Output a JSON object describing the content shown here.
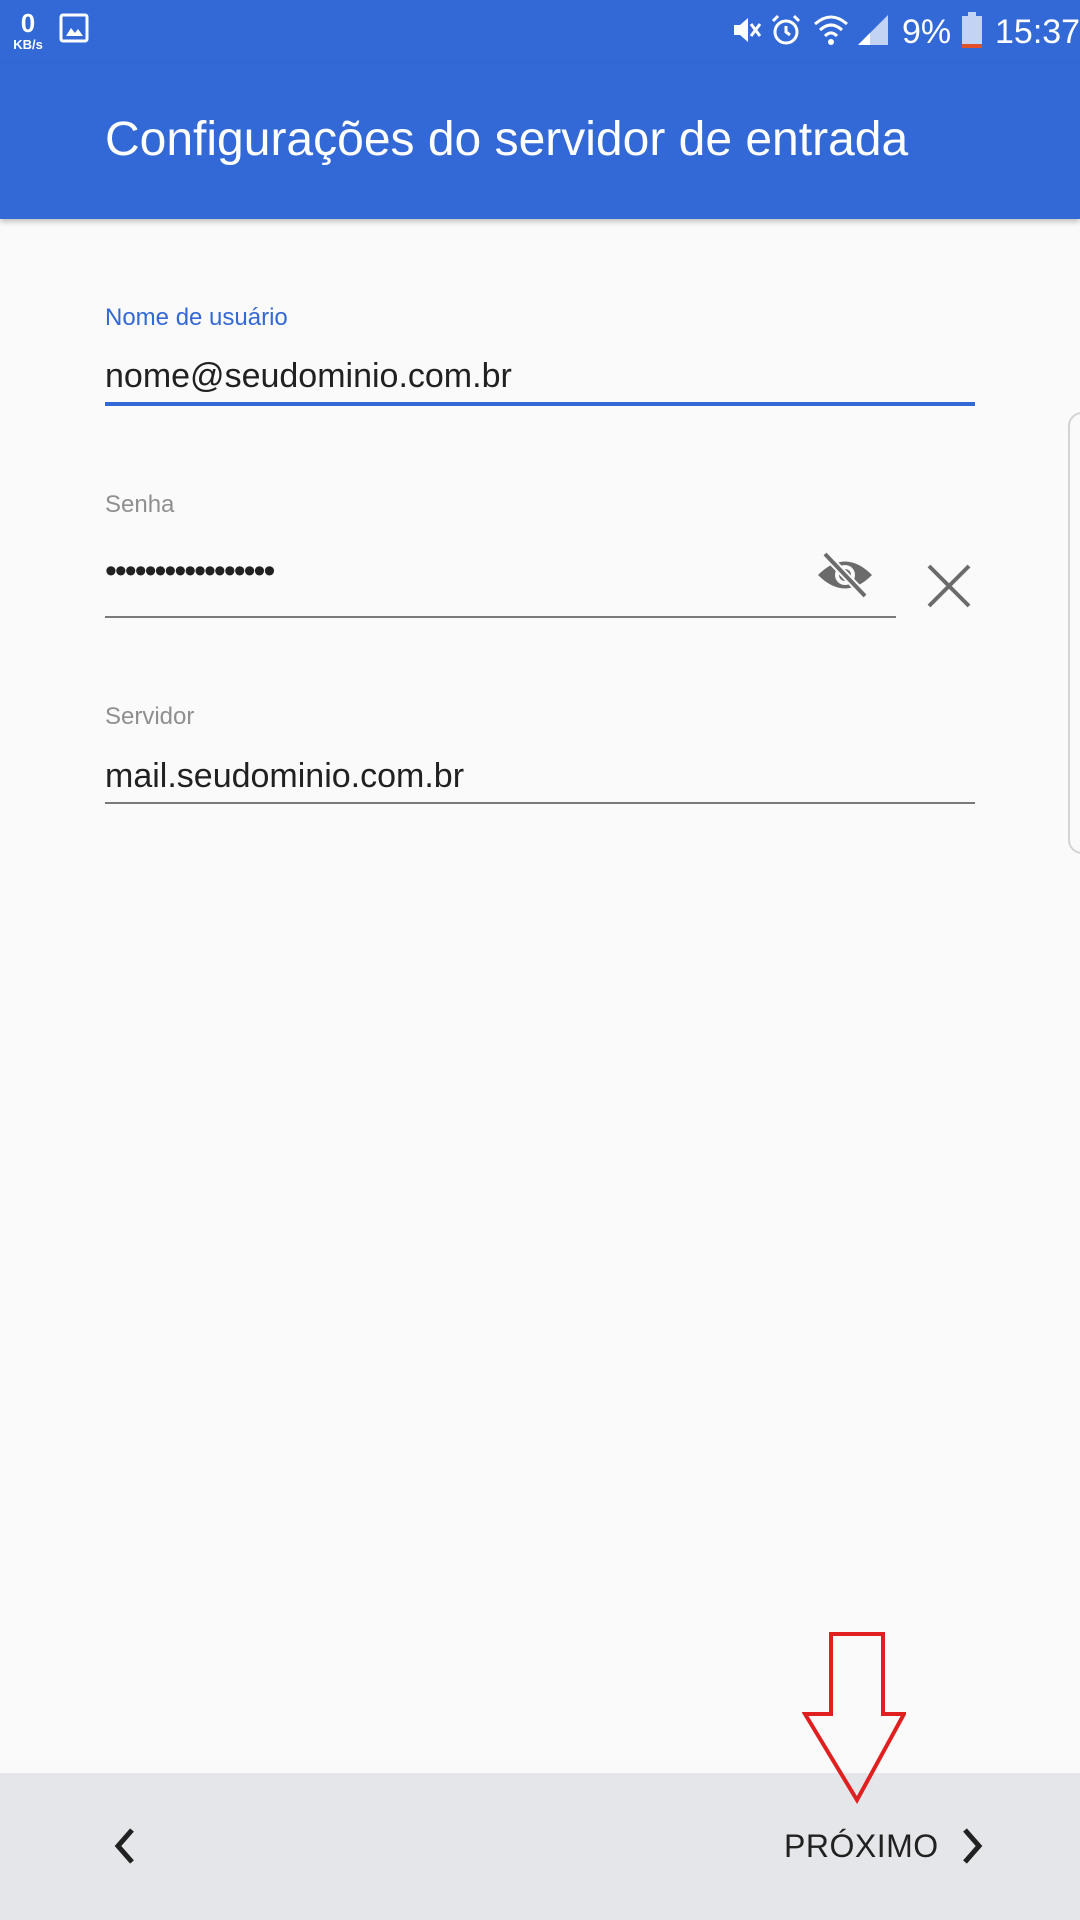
{
  "status_bar": {
    "net_speed_value": "0",
    "net_speed_unit": "KB/s",
    "battery_percent": "9%",
    "time": "15:37",
    "icons": [
      "gallery-icon",
      "mute-icon",
      "alarm-icon",
      "wifi-icon",
      "signal-icon",
      "battery-icon"
    ]
  },
  "header": {
    "title": "Configurações do servidor de entrada"
  },
  "form": {
    "username": {
      "label": "Nome de usuário",
      "value": "nome@seudominio.com.br"
    },
    "password": {
      "label": "Senha",
      "value": "•••••••••••••••••"
    },
    "server": {
      "label": "Servidor",
      "value": "mail.seudominio.com.br"
    }
  },
  "footer": {
    "next_label": "PRÓXIMO"
  },
  "colors": {
    "primary": "#3369d6",
    "background": "#fafafa",
    "bottom_bar": "#e4e6e9",
    "annotation_arrow": "#e02020"
  }
}
